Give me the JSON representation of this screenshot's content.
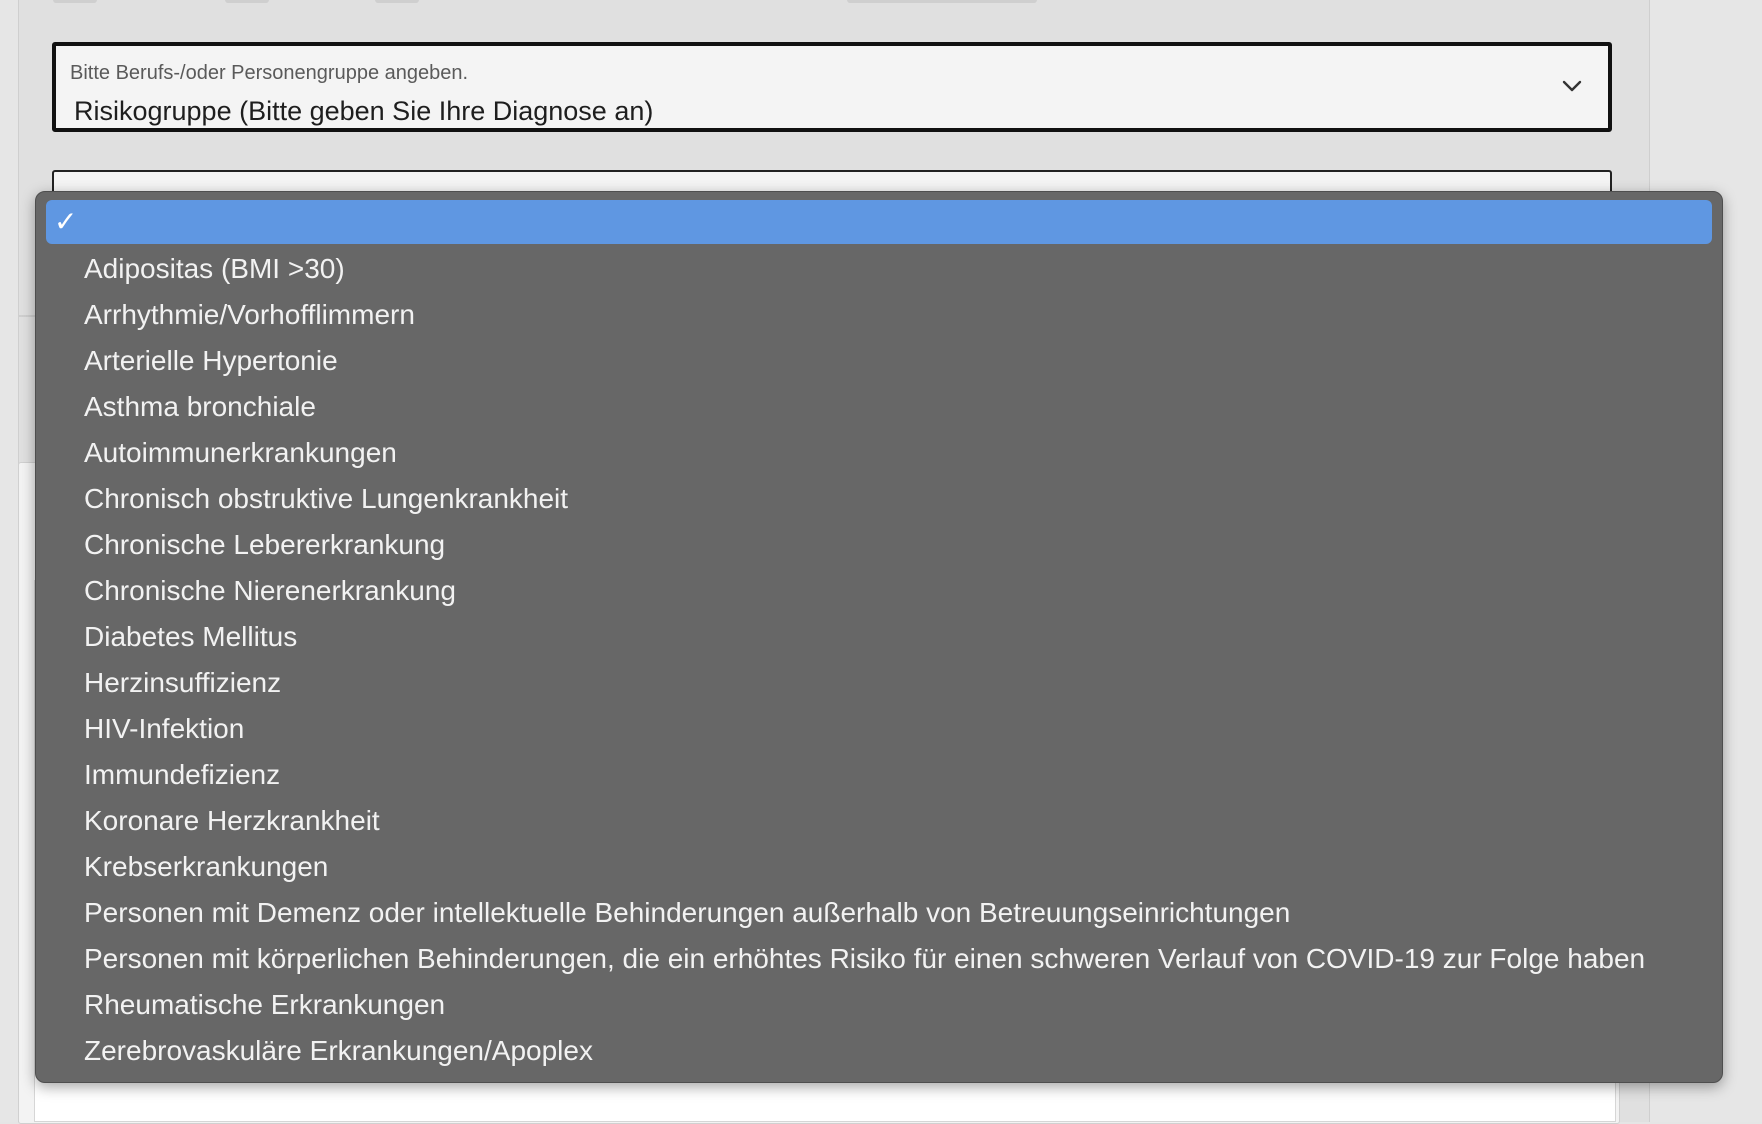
{
  "select": {
    "label": "Bitte Berufs-/oder Personengruppe angeben.",
    "value": "Risikogruppe (Bitte geben Sie Ihre Diagnose an)",
    "icon": "chevron-down-icon"
  },
  "dropdown": {
    "check_glyph": "✓",
    "selected_color": "#5f97e2",
    "background_color": "#676767",
    "items": [
      {
        "label": "",
        "selected": true
      },
      {
        "label": "Adipositas (BMI >30)"
      },
      {
        "label": "Arrhythmie/Vorhofflimmern"
      },
      {
        "label": "Arterielle Hypertonie"
      },
      {
        "label": "Asthma bronchiale"
      },
      {
        "label": "Autoimmunerkrankungen"
      },
      {
        "label": "Chronisch obstruktive Lungenkrankheit"
      },
      {
        "label": "Chronische Lebererkrankung"
      },
      {
        "label": "Chronische Nierenerkrankung"
      },
      {
        "label": "Diabetes Mellitus"
      },
      {
        "label": "Herzinsuffizienz"
      },
      {
        "label": "HIV-Infektion"
      },
      {
        "label": "Immundefizienz"
      },
      {
        "label": "Koronare Herzkrankheit"
      },
      {
        "label": "Krebserkrankungen"
      },
      {
        "label": "Personen mit Demenz oder intellektuelle Behinderungen außerhalb von Betreuungseinrichtungen"
      },
      {
        "label": "Personen mit körperlichen Behinderungen, die ein erhöhtes Risiko für einen schweren Verlauf von COVID-19 zur Folge haben"
      },
      {
        "label": "Rheumatische Erkrankungen"
      },
      {
        "label": "Zerebrovaskuläre Erkrankungen/Apoplex"
      }
    ]
  }
}
